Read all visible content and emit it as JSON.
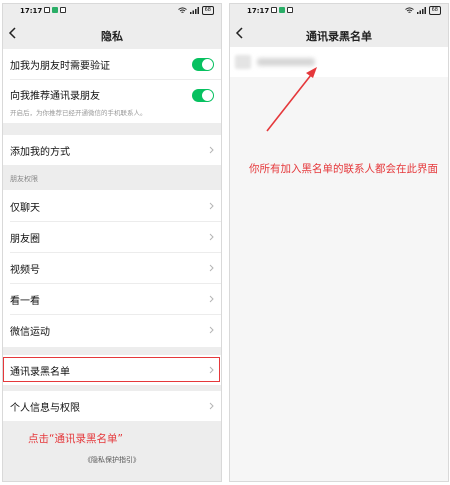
{
  "status_bar": {
    "time": "17:17",
    "battery": "68"
  },
  "left_screen": {
    "title": "隐私",
    "add_friend_verify": "加我为朋友时需要验证",
    "recommend_contacts": "向我推荐通讯录朋友",
    "recommend_hint": "开启后，为你推荐已经开通微信的手机联系人。",
    "add_me_methods": "添加我的方式",
    "friend_permissions_section": "朋友权限",
    "chat_only": "仅聊天",
    "moments": "朋友圈",
    "channels": "视频号",
    "top_stories": "看一看",
    "werun": "微信运动",
    "contacts_blacklist": "通讯录黑名单",
    "personal_info_permissions": "个人信息与权限",
    "red_caption": "点击“通讯录黑名单”",
    "privacy_guide": "《隐私保护指引》"
  },
  "right_screen": {
    "title": "通讯录黑名单",
    "red_note": "你所有加入黑名单的联系人都会在此界面"
  },
  "colors": {
    "accent_green": "#07c160",
    "annotation_red": "#e5383b"
  }
}
